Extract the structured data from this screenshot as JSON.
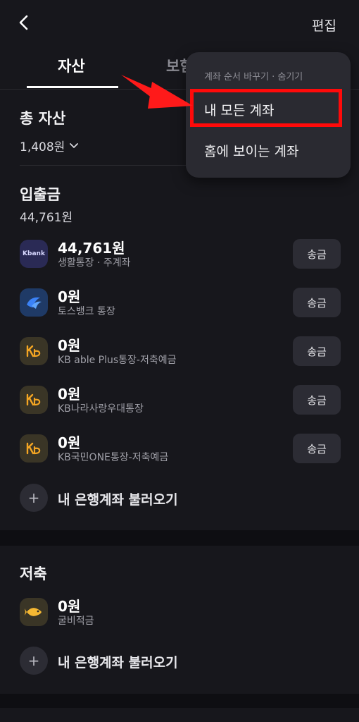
{
  "header": {
    "edit_label": "편집"
  },
  "tabs": [
    {
      "label": "자산",
      "active": true
    },
    {
      "label": "보험",
      "active": false
    }
  ],
  "total": {
    "title": "총 자산",
    "amount": "1,408원"
  },
  "deposit": {
    "title": "입출금",
    "total": "44,761원",
    "accounts": [
      {
        "icon": "kbank-logo-icon",
        "icon_text": "Kbank",
        "amount": "44,761원",
        "name": "생활통장 · 주계좌",
        "send_label": "송금"
      },
      {
        "icon": "toss-logo-icon",
        "amount": "0원",
        "name": "토스뱅크 통장",
        "send_label": "송금"
      },
      {
        "icon": "kb-logo-icon",
        "amount": "0원",
        "name": "KB able Plus통장-저축예금",
        "send_label": "송금"
      },
      {
        "icon": "kb-logo-icon",
        "amount": "0원",
        "name": "KB나라사랑우대통장",
        "send_label": "송금"
      },
      {
        "icon": "kb-logo-icon",
        "amount": "0원",
        "name": "KB국민ONE통장-저축예금",
        "send_label": "송금"
      }
    ],
    "add_label": "내 은행계좌 불러오기"
  },
  "savings": {
    "title": "저축",
    "accounts": [
      {
        "icon": "fish-icon",
        "amount": "0원",
        "name": "굴비적금"
      }
    ],
    "add_label": "내 은행계좌 불러오기"
  },
  "dropdown": {
    "header": "계좌 순서 바꾸기 · 숨기기",
    "items": [
      "내 모든 계좌",
      "홈에 보이는 계좌"
    ]
  },
  "colors": {
    "background": "#17171c",
    "highlight": "#ff0a0a",
    "kb_yellow": "#f5a623"
  }
}
